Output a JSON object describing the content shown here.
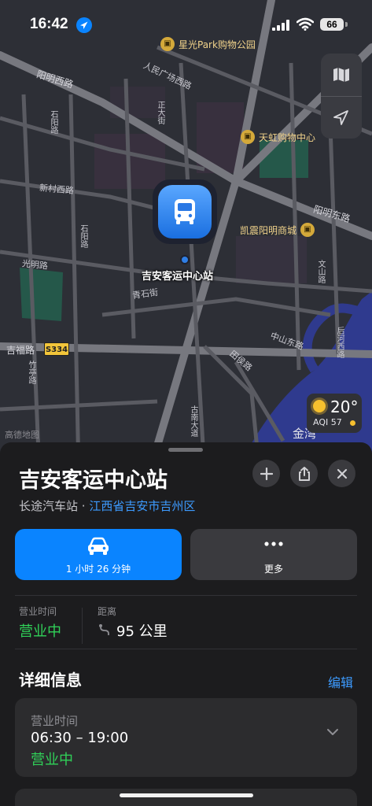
{
  "status_bar": {
    "time": "16:42",
    "battery": "66"
  },
  "map": {
    "roads": [
      "阳明西路",
      "人民广场西路",
      "阳明东路",
      "新村西路",
      "光明路",
      "吉福路",
      "石阳路",
      "青石街",
      "中山东路",
      "田侯路",
      "古南大道",
      "竹亭路",
      "石阳路",
      "正大街",
      "文山路",
      "后河西路"
    ],
    "highway_shield": "S334",
    "pois": [
      "星光Park购物公园",
      "天虹购物中心",
      "凯震阳明商城"
    ],
    "pin_label": "吉安客运中心站",
    "partial_label": "金湾",
    "brand_watermark": "高德地图",
    "weather": {
      "temp": "20°",
      "aqi": "AQI 57"
    },
    "icons": {
      "map_mode": "map-icon",
      "locate": "location-arrow-icon"
    }
  },
  "sheet": {
    "title": "吉安客运中心站",
    "category": "长途汽车站 · ",
    "location_link": "江西省吉安市吉州区",
    "actions": {
      "drive_label": "1 小时 26 分钟",
      "more_label": "更多"
    },
    "hours_label": "营业时间",
    "hours_status": "营业中",
    "distance_label": "距离",
    "distance_value": "95 公里",
    "details_heading": "详细信息",
    "edit_label": "编辑",
    "card": {
      "key": "营业时间",
      "hours": "06:30 – 19:00",
      "status": "营业中"
    }
  }
}
